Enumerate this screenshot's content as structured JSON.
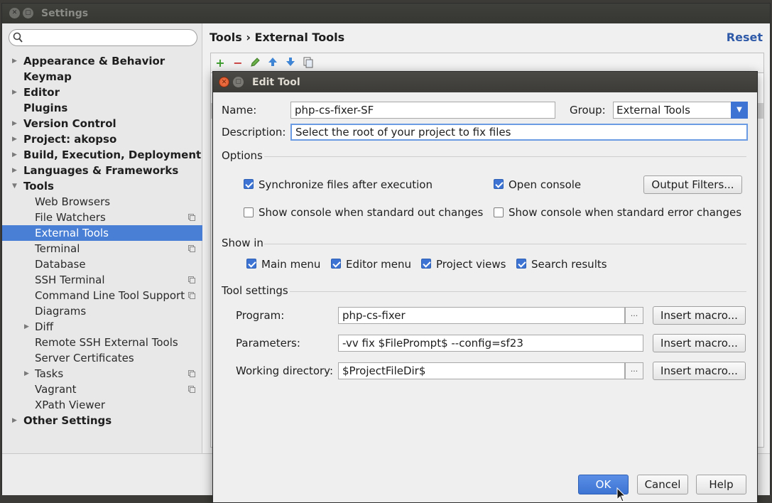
{
  "settings": {
    "title": "Settings",
    "search_placeholder": "",
    "breadcrumb": "Tools › External Tools",
    "reset": "Reset",
    "tree": [
      {
        "label": "Appearance & Behavior",
        "level": 0,
        "arrow": "right"
      },
      {
        "label": "Keymap",
        "level": 0,
        "arrow": ""
      },
      {
        "label": "Editor",
        "level": 0,
        "arrow": "right"
      },
      {
        "label": "Plugins",
        "level": 0,
        "arrow": ""
      },
      {
        "label": "Version Control",
        "level": 0,
        "arrow": "right"
      },
      {
        "label": "Project: akopso",
        "level": 0,
        "arrow": "right"
      },
      {
        "label": "Build, Execution, Deployment",
        "level": 0,
        "arrow": "right"
      },
      {
        "label": "Languages & Frameworks",
        "level": 0,
        "arrow": "right"
      },
      {
        "label": "Tools",
        "level": 0,
        "arrow": "down"
      },
      {
        "label": "Web Browsers",
        "level": 1,
        "arrow": ""
      },
      {
        "label": "File Watchers",
        "level": 1,
        "arrow": "",
        "project": true
      },
      {
        "label": "External Tools",
        "level": 1,
        "arrow": "",
        "selected": true
      },
      {
        "label": "Terminal",
        "level": 1,
        "arrow": "",
        "project": true
      },
      {
        "label": "Database",
        "level": 1,
        "arrow": ""
      },
      {
        "label": "SSH Terminal",
        "level": 1,
        "arrow": "",
        "project": true
      },
      {
        "label": "Command Line Tool Support",
        "level": 1,
        "arrow": "",
        "project": true
      },
      {
        "label": "Diagrams",
        "level": 1,
        "arrow": ""
      },
      {
        "label": "Diff",
        "level": 1,
        "arrow": "right"
      },
      {
        "label": "Remote SSH External Tools",
        "level": 1,
        "arrow": ""
      },
      {
        "label": "Server Certificates",
        "level": 1,
        "arrow": ""
      },
      {
        "label": "Tasks",
        "level": 1,
        "arrow": "right",
        "project": true
      },
      {
        "label": "Vagrant",
        "level": 1,
        "arrow": "",
        "project": true
      },
      {
        "label": "XPath Viewer",
        "level": 1,
        "arrow": ""
      },
      {
        "label": "Other Settings",
        "level": 0,
        "arrow": "right"
      }
    ]
  },
  "dialog": {
    "title": "Edit Tool",
    "name_label": "Name:",
    "name_value": "php-cs-fixer-SF",
    "group_label": "Group:",
    "group_value": "External Tools",
    "description_label": "Description:",
    "description_value": "Select the root of your project to fix files",
    "options_section": "Options",
    "sync_files": "Synchronize files after execution",
    "open_console": "Open console",
    "output_filters": "Output Filters...",
    "show_console_out": "Show console when standard out changes",
    "show_console_err": "Show console when standard error changes",
    "show_in_section": "Show in",
    "main_menu": "Main menu",
    "editor_menu": "Editor menu",
    "project_views": "Project views",
    "search_results": "Search results",
    "tool_settings_section": "Tool settings",
    "program_label": "Program:",
    "program_value": "php-cs-fixer",
    "parameters_label": "Parameters:",
    "parameters_value": "-vv fix $FilePrompt$ --config=sf23",
    "working_dir_label": "Working directory:",
    "working_dir_value": "$ProjectFileDir$",
    "browse": "...",
    "insert_macro": "Insert macro...",
    "ok": "OK",
    "cancel": "Cancel",
    "help": "Help"
  },
  "colors": {
    "accent": "#3d74d3",
    "selection": "#4a7fd6",
    "titlebar": "#3c3b37",
    "close_button": "#e9622f"
  }
}
